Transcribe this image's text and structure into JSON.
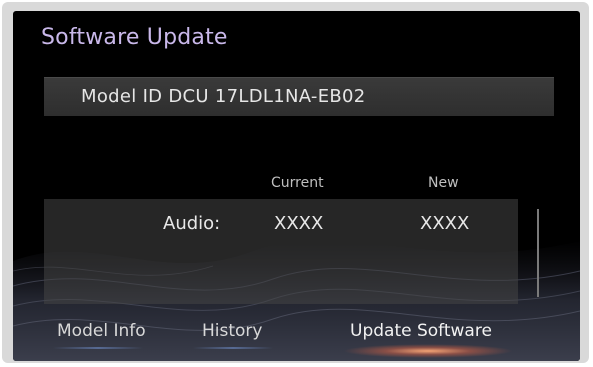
{
  "screen": {
    "title": "Software Update",
    "model_line": "Model ID DCU 17LDL1NA-EB02"
  },
  "table": {
    "headers": {
      "current": "Current",
      "new": "New"
    },
    "rows": [
      {
        "label": "Audio:",
        "current": "XXXX",
        "new": "XXXX"
      }
    ]
  },
  "tabs": [
    {
      "label": "Model Info",
      "active": false
    },
    {
      "label": "History",
      "active": false
    },
    {
      "label": "Update Software",
      "active": true
    }
  ],
  "colors": {
    "title": "#c9b8ea",
    "active_glow": "#ff9f70"
  }
}
